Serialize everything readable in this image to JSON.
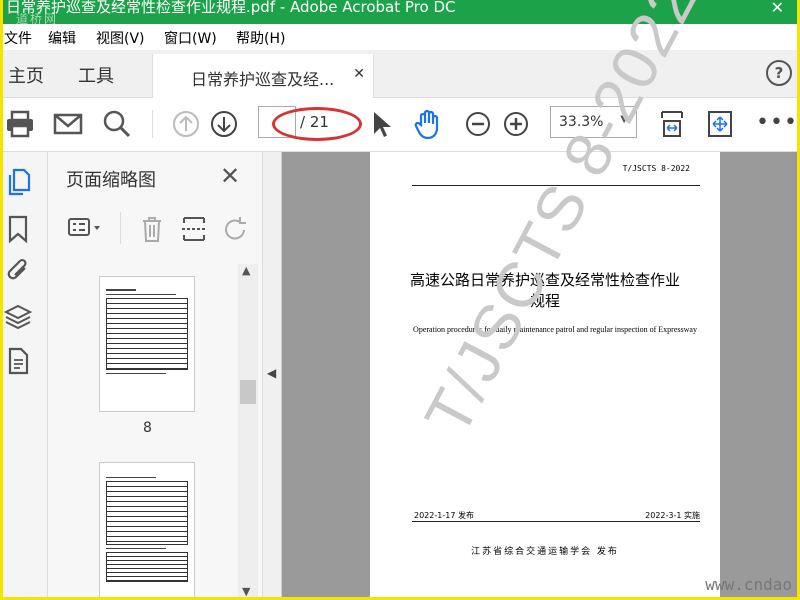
{
  "window": {
    "title": "日常养护巡查及经常性检查作业规程.pdf - Adobe Acrobat Pro DC",
    "watermark": "道桥网"
  },
  "menu": [
    "文件",
    "编辑",
    "视图(V)",
    "窗口(W)",
    "帮助(H)"
  ],
  "tabs": {
    "home": "主页",
    "tools": "工具",
    "document": "日常养护巡查及经..."
  },
  "toolbar": {
    "page_current": "",
    "page_total": "/ 21",
    "zoom": "33.3%"
  },
  "panel": {
    "title": "页面缩略图",
    "thumb_labels": [
      "8"
    ]
  },
  "document": {
    "code": "T/JSCTS 8-2022",
    "title_line1": "高速公路日常养护巡查及经常性检查作业",
    "title_line2": "规程",
    "english_title": "Operation procedures for daily maintenance patrol and regular inspection of Expressway",
    "watermark": "T/JSCTS 8-2022",
    "issue_date": "2022-1-17 发布",
    "effective_date": "2022-3-1 实施",
    "publisher": "江苏省综合交通运输学会     发布"
  },
  "site_watermark": "www.cndao",
  "colors": {
    "titlebar": "#1ca34a",
    "frame": "#f4e400",
    "accent_blue": "#1a73e8",
    "highlight_oval": "#d63333"
  }
}
